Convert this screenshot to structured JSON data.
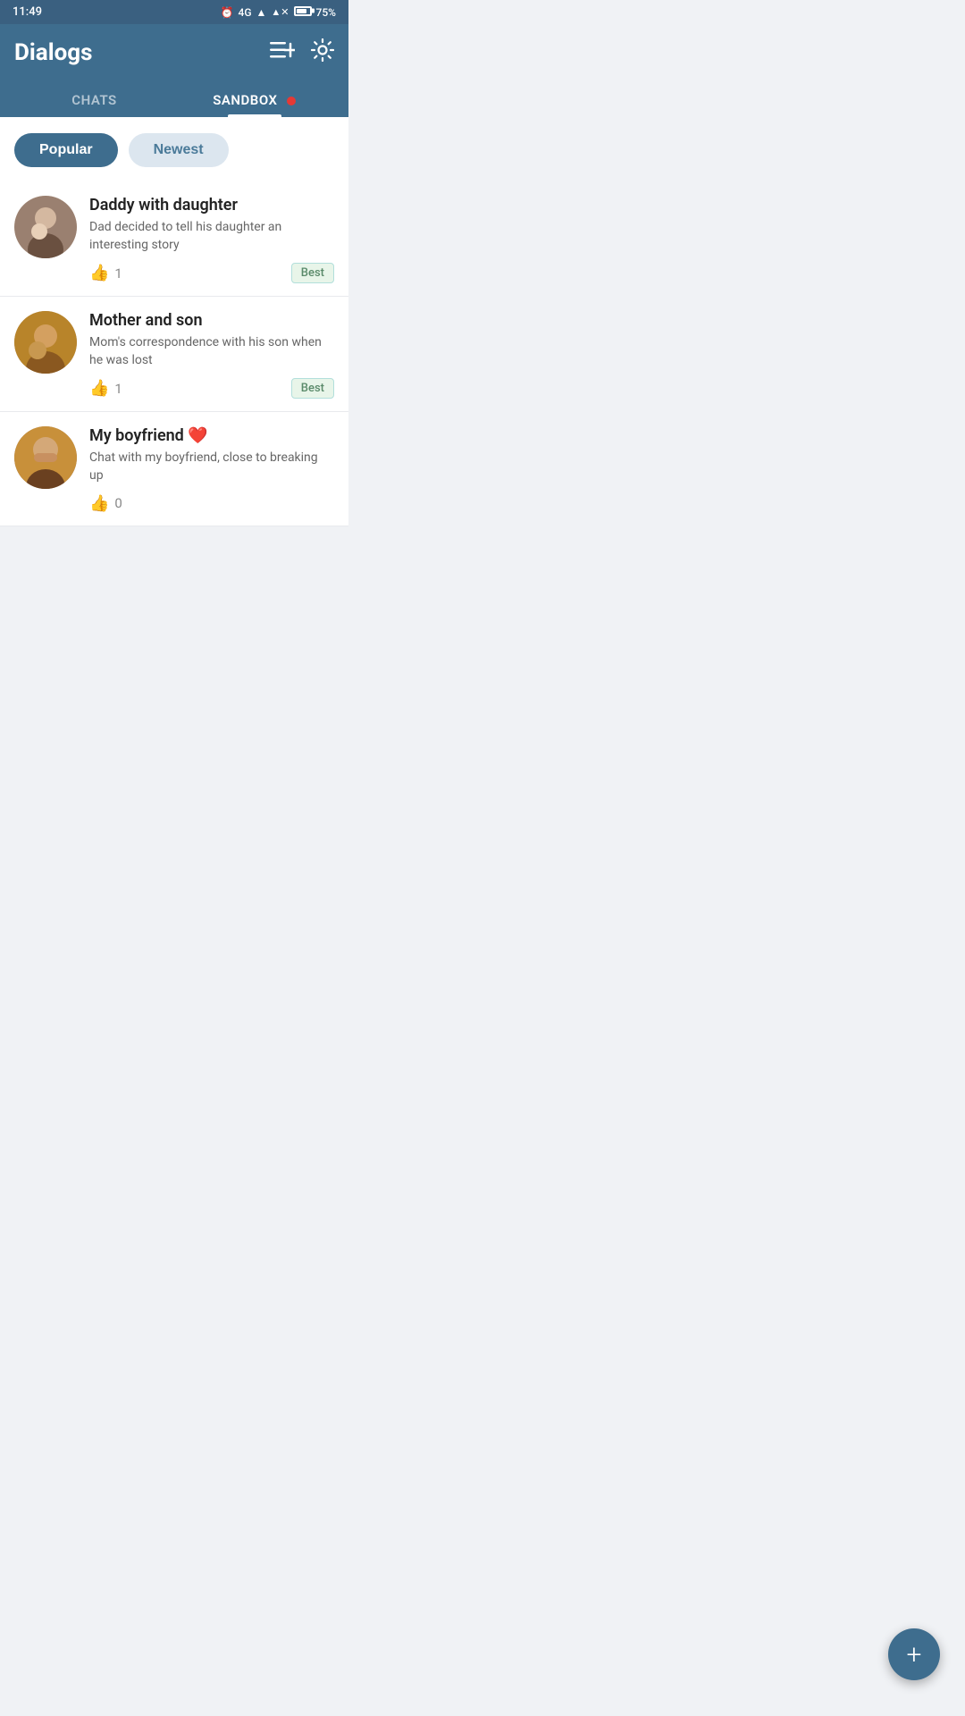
{
  "statusBar": {
    "time": "11:49",
    "network": "4G",
    "battery": "75%"
  },
  "header": {
    "title": "Dialogs",
    "newChatIcon": "≡+",
    "settingsIcon": "⚙"
  },
  "tabs": [
    {
      "id": "chats",
      "label": "CHATS",
      "active": false,
      "badge": false
    },
    {
      "id": "sandbox",
      "label": "SANDBOX",
      "active": true,
      "badge": true
    }
  ],
  "filters": [
    {
      "id": "popular",
      "label": "Popular",
      "active": true
    },
    {
      "id": "newest",
      "label": "Newest",
      "active": false
    }
  ],
  "chats": [
    {
      "id": 1,
      "title": "Daddy with daughter",
      "description": "Dad decided to tell his daughter an interesting story",
      "likes": 1,
      "badge": "Best",
      "avatarClass": "avatar-1",
      "emoji": ""
    },
    {
      "id": 2,
      "title": "Mother and son",
      "description": "Mom's correspondence with his son when he was lost",
      "likes": 1,
      "badge": "Best",
      "avatarClass": "avatar-2",
      "emoji": ""
    },
    {
      "id": 3,
      "title": "My boyfriend",
      "titleEmoji": "❤️",
      "description": "Chat with my boyfriend, close to breaking up",
      "likes": 0,
      "badge": null,
      "avatarClass": "avatar-3",
      "emoji": "❤️"
    }
  ],
  "fab": {
    "label": "+"
  }
}
